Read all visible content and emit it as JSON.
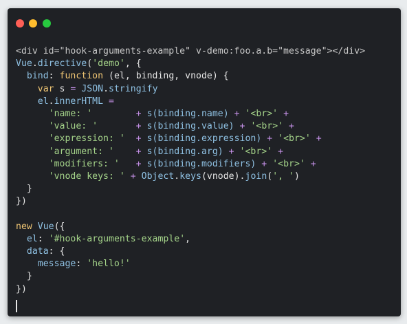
{
  "window": {
    "controls": [
      "close",
      "minimize",
      "maximize"
    ]
  },
  "colors": {
    "background": "#e9ecee",
    "editor_bg": "#1f2125",
    "text": "#e6e6e6",
    "keyword": "#f0c674",
    "property": "#8fc1e3",
    "string": "#a5d48a",
    "operator": "#c792ea",
    "close_dot": "#ff5f56",
    "minimize_dot": "#ffbd2e",
    "maximize_dot": "#27c93f"
  },
  "code_lines": [
    [
      {
        "t": "<div id=\"hook-arguments-example\" v-demo:foo.a.b=\"message\"></div>",
        "c": "t-tag"
      }
    ],
    [
      {
        "t": "Vue",
        "c": "t-prop"
      },
      {
        "t": ".",
        "c": "t-text"
      },
      {
        "t": "directive",
        "c": "t-prop"
      },
      {
        "t": "(",
        "c": "t-text"
      },
      {
        "t": "'demo'",
        "c": "t-str"
      },
      {
        "t": ", {",
        "c": "t-text"
      }
    ],
    [
      {
        "t": "  ",
        "c": "t-ws"
      },
      {
        "t": "bind",
        "c": "t-prop"
      },
      {
        "t": ": ",
        "c": "t-text"
      },
      {
        "t": "function",
        "c": "t-kw"
      },
      {
        "t": " (el, binding, vnode) {",
        "c": "t-text"
      }
    ],
    [
      {
        "t": "    ",
        "c": "t-ws"
      },
      {
        "t": "var",
        "c": "t-kw"
      },
      {
        "t": " s ",
        "c": "t-text"
      },
      {
        "t": "=",
        "c": "t-op"
      },
      {
        "t": " ",
        "c": "t-ws"
      },
      {
        "t": "JSON",
        "c": "t-prop"
      },
      {
        "t": ".",
        "c": "t-text"
      },
      {
        "t": "stringify",
        "c": "t-prop"
      }
    ],
    [
      {
        "t": "    ",
        "c": "t-ws"
      },
      {
        "t": "el",
        "c": "t-prop"
      },
      {
        "t": ".",
        "c": "t-text"
      },
      {
        "t": "innerHTML",
        "c": "t-prop"
      },
      {
        "t": " ",
        "c": "t-ws"
      },
      {
        "t": "=",
        "c": "t-op"
      }
    ],
    [
      {
        "t": "      ",
        "c": "t-ws"
      },
      {
        "t": "'name: '       ",
        "c": "t-str"
      },
      {
        "t": " + ",
        "c": "t-op"
      },
      {
        "t": "s(binding.name)",
        "c": "t-prop"
      },
      {
        "t": " + ",
        "c": "t-op"
      },
      {
        "t": "'<br>'",
        "c": "t-str"
      },
      {
        "t": " +",
        "c": "t-op"
      }
    ],
    [
      {
        "t": "      ",
        "c": "t-ws"
      },
      {
        "t": "'value: '      ",
        "c": "t-str"
      },
      {
        "t": " + ",
        "c": "t-op"
      },
      {
        "t": "s(binding.value)",
        "c": "t-prop"
      },
      {
        "t": " + ",
        "c": "t-op"
      },
      {
        "t": "'<br>'",
        "c": "t-str"
      },
      {
        "t": " +",
        "c": "t-op"
      }
    ],
    [
      {
        "t": "      ",
        "c": "t-ws"
      },
      {
        "t": "'expression: ' ",
        "c": "t-str"
      },
      {
        "t": " + ",
        "c": "t-op"
      },
      {
        "t": "s(binding.expression)",
        "c": "t-prop"
      },
      {
        "t": " + ",
        "c": "t-op"
      },
      {
        "t": "'<br>'",
        "c": "t-str"
      },
      {
        "t": " +",
        "c": "t-op"
      }
    ],
    [
      {
        "t": "      ",
        "c": "t-ws"
      },
      {
        "t": "'argument: '   ",
        "c": "t-str"
      },
      {
        "t": " + ",
        "c": "t-op"
      },
      {
        "t": "s(binding.arg)",
        "c": "t-prop"
      },
      {
        "t": " + ",
        "c": "t-op"
      },
      {
        "t": "'<br>'",
        "c": "t-str"
      },
      {
        "t": " +",
        "c": "t-op"
      }
    ],
    [
      {
        "t": "      ",
        "c": "t-ws"
      },
      {
        "t": "'modifiers: '  ",
        "c": "t-str"
      },
      {
        "t": " + ",
        "c": "t-op"
      },
      {
        "t": "s(binding.modifiers)",
        "c": "t-prop"
      },
      {
        "t": " + ",
        "c": "t-op"
      },
      {
        "t": "'<br>'",
        "c": "t-str"
      },
      {
        "t": " +",
        "c": "t-op"
      }
    ],
    [
      {
        "t": "      ",
        "c": "t-ws"
      },
      {
        "t": "'vnode keys: ' ",
        "c": "t-str"
      },
      {
        "t": "+ ",
        "c": "t-op"
      },
      {
        "t": "Object",
        "c": "t-prop"
      },
      {
        "t": ".",
        "c": "t-text"
      },
      {
        "t": "keys",
        "c": "t-prop"
      },
      {
        "t": "(vnode).",
        "c": "t-text"
      },
      {
        "t": "join",
        "c": "t-prop"
      },
      {
        "t": "(",
        "c": "t-text"
      },
      {
        "t": "', '",
        "c": "t-str"
      },
      {
        "t": ")",
        "c": "t-text"
      }
    ],
    [
      {
        "t": "  }",
        "c": "t-text"
      }
    ],
    [
      {
        "t": "})",
        "c": "t-text"
      }
    ],
    [
      {
        "t": "",
        "c": "t-text"
      }
    ],
    [
      {
        "t": "new",
        "c": "t-kw"
      },
      {
        "t": " ",
        "c": "t-ws"
      },
      {
        "t": "Vue",
        "c": "t-prop"
      },
      {
        "t": "({",
        "c": "t-text"
      }
    ],
    [
      {
        "t": "  ",
        "c": "t-ws"
      },
      {
        "t": "el",
        "c": "t-prop"
      },
      {
        "t": ": ",
        "c": "t-text"
      },
      {
        "t": "'#hook-arguments-example'",
        "c": "t-str"
      },
      {
        "t": ",",
        "c": "t-text"
      }
    ],
    [
      {
        "t": "  ",
        "c": "t-ws"
      },
      {
        "t": "data",
        "c": "t-prop"
      },
      {
        "t": ": {",
        "c": "t-text"
      }
    ],
    [
      {
        "t": "    ",
        "c": "t-ws"
      },
      {
        "t": "message",
        "c": "t-prop"
      },
      {
        "t": ": ",
        "c": "t-text"
      },
      {
        "t": "'hello!'",
        "c": "t-str"
      }
    ],
    [
      {
        "t": "  }",
        "c": "t-text"
      }
    ],
    [
      {
        "t": "})",
        "c": "t-text"
      }
    ]
  ]
}
